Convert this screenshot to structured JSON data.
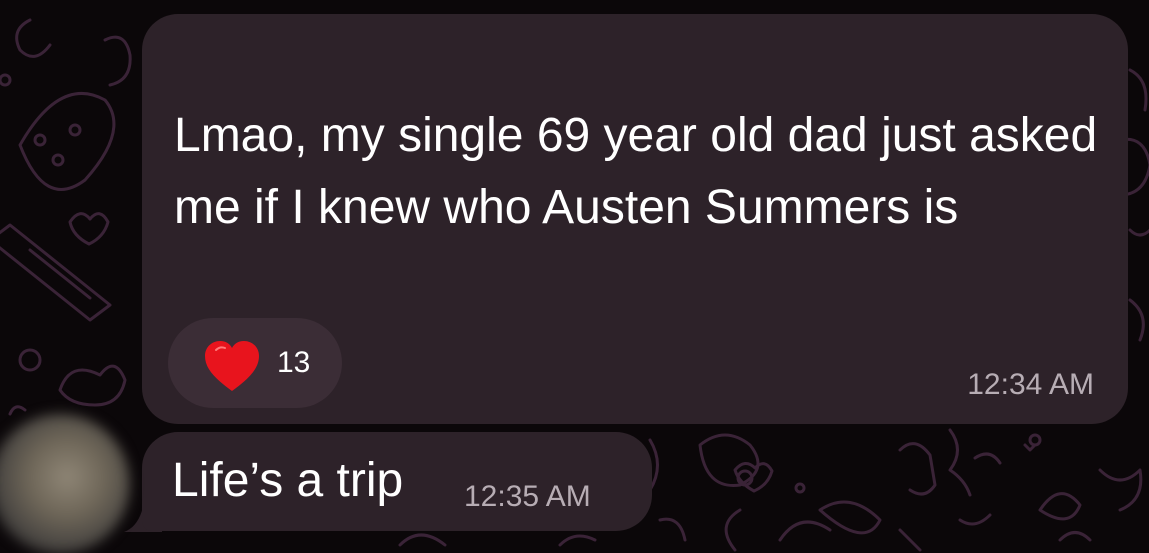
{
  "messages": [
    {
      "text": "Lmao, my single 69 year old dad just asked me if I knew who Austen Summers is",
      "time": "12:34 AM",
      "reaction": {
        "icon": "heart-icon",
        "count": "13",
        "color": "#e8141d"
      }
    },
    {
      "text": "Life’s a trip",
      "time": "12:35 AM"
    }
  ],
  "colors": {
    "background": "#0b0709",
    "bubble": "#2d2229",
    "reaction_pill": "#3b2d36",
    "timestamp": "#b7adb4",
    "wallpaper_doodle": "#3a2337"
  }
}
